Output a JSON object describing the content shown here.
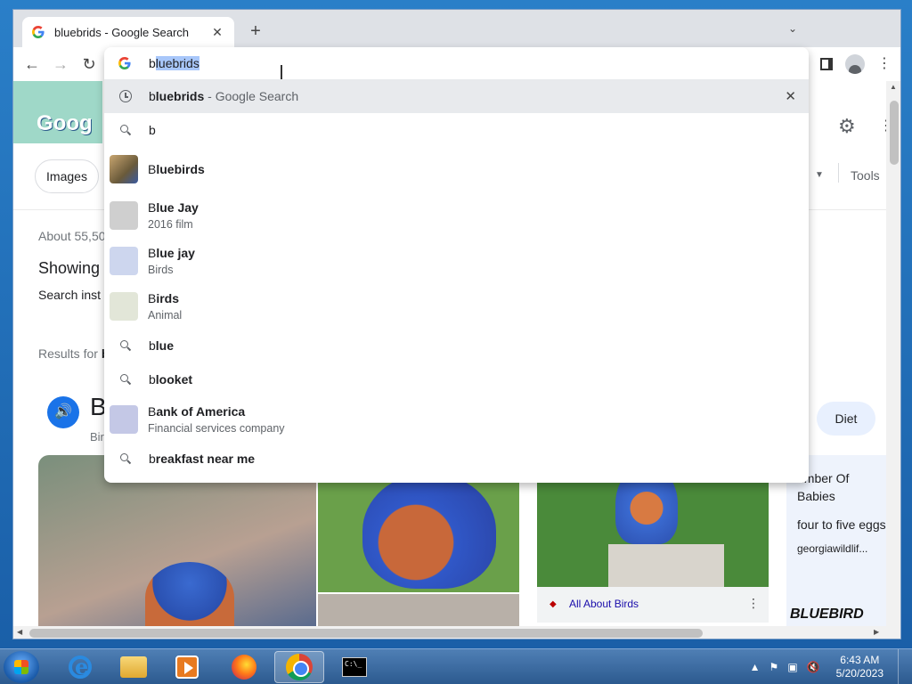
{
  "browser": {
    "tab_title": "bluebrids - Google Search",
    "tab_close": "✕",
    "new_tab": "+",
    "tab_search": "⌄",
    "window_controls": [
      "▭",
      "▣",
      "✕"
    ]
  },
  "omnibox": {
    "typed": "b",
    "autocompleted": "luebrids",
    "suggestions": [
      {
        "type": "history",
        "bold": "luebrids",
        "prefix": "b",
        "suffix": " - Google Search",
        "remove": "✕"
      },
      {
        "type": "search",
        "prefix": "b",
        "bold": ""
      },
      {
        "type": "entity",
        "prefix": "B",
        "bold": "luebirds",
        "thumb_color": "#8a7a5a"
      },
      {
        "type": "entity",
        "prefix": "B",
        "bold": "lue Jay",
        "sub": "2016 film",
        "thumb_color": "#cfcfcf"
      },
      {
        "type": "entity",
        "prefix": "B",
        "bold": "lue jay",
        "sub": "Birds",
        "thumb_color": "#cdd6ee"
      },
      {
        "type": "entity",
        "prefix": "B",
        "bold": "irds",
        "sub": "Animal",
        "thumb_color": "#e2e6d8"
      },
      {
        "type": "search",
        "prefix": "b",
        "bold": "lue"
      },
      {
        "type": "search",
        "prefix": "b",
        "bold": "looket"
      },
      {
        "type": "entity",
        "prefix": "B",
        "bold": "ank of America",
        "sub": "Financial services company",
        "thumb_color": "#c4c8e6"
      },
      {
        "type": "search",
        "prefix": "b",
        "bold": "reakfast near me"
      }
    ]
  },
  "page": {
    "doodle_text": "Goog",
    "chip_images": "Images",
    "tools": "Tools",
    "about": "About 55,50",
    "showing": "Showing",
    "search_instead": "Search inst",
    "results_for": "Results for",
    "results_for_bold": "b",
    "kp_title": "B",
    "kp_sub": "Bir",
    "chip_diet": "Diet",
    "source_name": "All About Birds",
    "side_label": "umber Of Babies",
    "side_value": "four to five eggs",
    "side_source": "georgiawildlif...",
    "side_watermark": "BLUEBIRD"
  },
  "taskbar": {
    "time": "6:43 AM",
    "date": "5/20/2023",
    "cmd_text": "C:\\_"
  }
}
